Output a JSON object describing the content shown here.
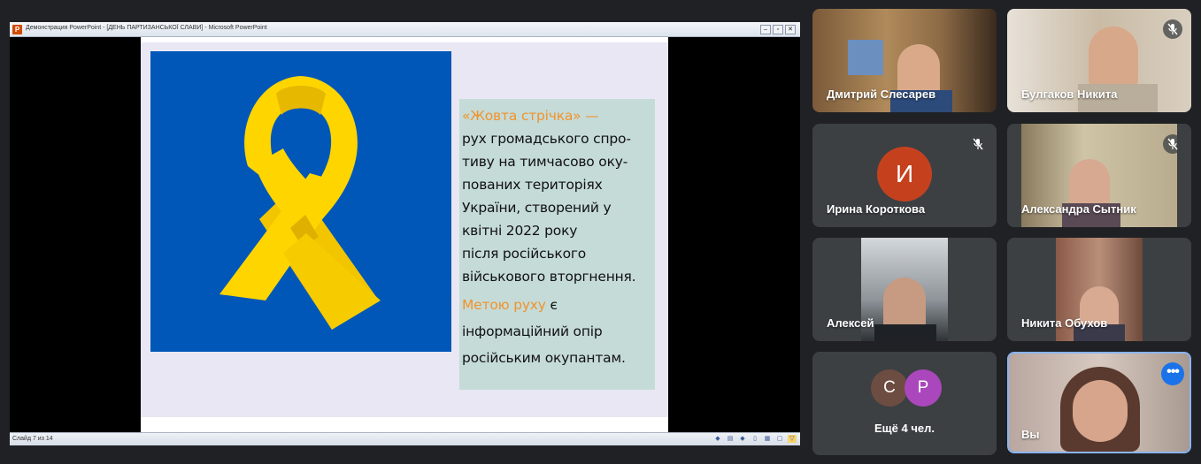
{
  "presentation": {
    "window_title": "Демонстрация PowerPoint - [ДЕНЬ ПАРТИЗАНСЬКОЇ СЛАВИ] - Microsoft PowerPoint",
    "app_icon_letter": "P",
    "status_text": "Слайд 7 из 14",
    "window_buttons": [
      "–",
      "▫",
      "✕"
    ]
  },
  "slide": {
    "colors": {
      "blue": "#0057b8",
      "yellow": "#ffd500",
      "orange": "#f0932b",
      "text_bg": "#c5dbd8"
    },
    "lines": [
      "«Жовта стрічка» —",
      "рух громадського спро-",
      "тиву на тимчасово оку-",
      "пованих територіях",
      "України, створений у",
      "квітні 2022 року",
      "після російського",
      "військового вторгнення.",
      "Метою руху",
      " є",
      "інформаційний опір",
      "російським окупантам."
    ]
  },
  "participants": [
    {
      "name": "Дмитрий Слесарев",
      "muted": false
    },
    {
      "name": "Булгаков Никита",
      "muted": true
    },
    {
      "name": "Ирина Короткова",
      "muted": true,
      "initial": "И",
      "avatar_color": "#c5411e"
    },
    {
      "name": "Александра Сытник",
      "muted": true
    },
    {
      "name": "Алексей",
      "muted": false
    },
    {
      "name": "Никита Обухов",
      "muted": false
    }
  ],
  "more": {
    "label": "Ещё 4 чел.",
    "avatars": [
      {
        "initial": "С",
        "color": "#6d4c41"
      },
      {
        "initial": "Р",
        "color": "#ab47bc"
      }
    ]
  },
  "self": {
    "name": "Вы",
    "menu_dots": "•••"
  }
}
